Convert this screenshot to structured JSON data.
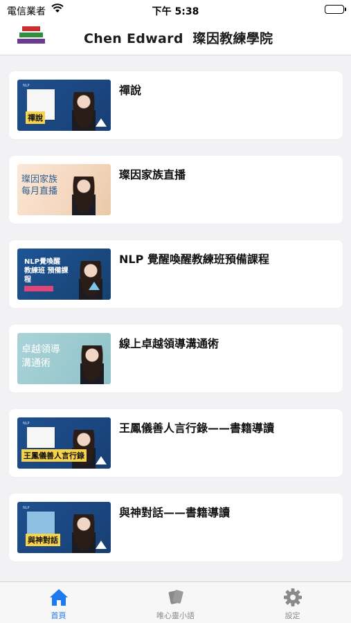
{
  "status_bar": {
    "carrier": "電信業者",
    "time": "下午 5:38"
  },
  "nav": {
    "title": "Chen Edward  璨因教練學院",
    "logo_colors": [
      "#cf2d2d",
      "#2f8f3e",
      "#6a3b8e"
    ]
  },
  "courses": [
    {
      "title": "禪說",
      "thumb_text": "禪說"
    },
    {
      "title": "璨因家族直播",
      "thumb_text": "璨因家族 每月直播"
    },
    {
      "title": "NLP 覺醒喚醒教練班預備課程",
      "thumb_text": "NLP覺喚醒 教練班 預備課程"
    },
    {
      "title": "線上卓越領導溝通術",
      "thumb_text": "卓越領導 溝通術"
    },
    {
      "title": "王鳳儀善人言行錄——書籍導讀",
      "thumb_text": "王鳳儀善人言行錄"
    },
    {
      "title": "與神對話——書籍導讀",
      "thumb_text": "與神對話"
    }
  ],
  "tabs": [
    {
      "label": "首頁",
      "icon": "home-icon",
      "active": true
    },
    {
      "label": "唯心靈小語",
      "icon": "cards-icon",
      "active": false
    },
    {
      "label": "設定",
      "icon": "gear-icon",
      "active": false
    }
  ],
  "colors": {
    "accent": "#1e7af2",
    "inactive": "#8a8a8a"
  }
}
